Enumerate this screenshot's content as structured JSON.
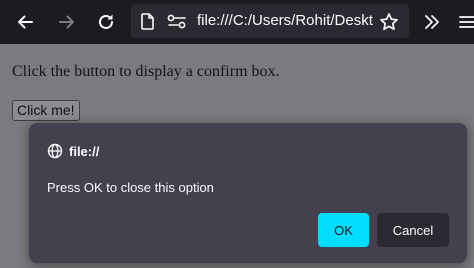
{
  "browser": {
    "url": "file:///C:/Users/Rohit/Deskt",
    "icons": {
      "back": "back-arrow-icon",
      "forward": "forward-arrow-icon",
      "reload": "reload-icon",
      "page": "page-icon",
      "permissions": "permissions-icon",
      "bookmark": "star-icon",
      "overflow": "chevron-double-right-icon",
      "menu": "hamburger-menu-icon"
    }
  },
  "page": {
    "text": "Click the button to display a confirm box.",
    "button_label": "Click me!"
  },
  "dialog": {
    "origin": "file://",
    "message": "Press OK to close this option",
    "ok_label": "OK",
    "cancel_label": "Cancel",
    "icon": "globe-icon"
  },
  "colors": {
    "toolbar": "#1c1b22",
    "urlbar": "#2b2a33",
    "page_dimmed": "#7b7b7f",
    "dialog": "#42414d",
    "accent": "#00ddff"
  }
}
